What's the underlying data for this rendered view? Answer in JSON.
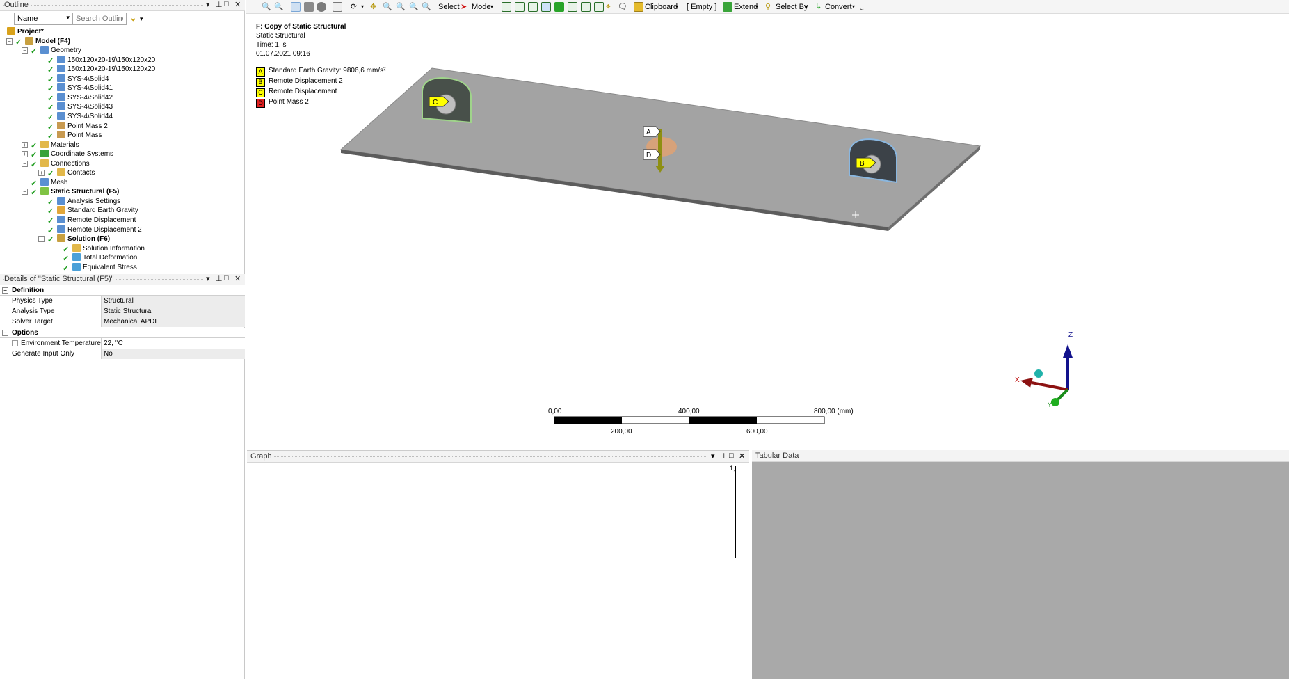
{
  "outline": {
    "title": "Outline",
    "filter_name": "Name",
    "search_placeholder": "Search Outline",
    "tree": [
      {
        "label": "Project*",
        "level": 0,
        "bold": true,
        "icon": "project-icon",
        "icon_color": "#d9a21b"
      },
      {
        "label": "Model (F4)",
        "level": 1,
        "bold": true,
        "icon": "model-icon",
        "icon_color": "#c8a040"
      },
      {
        "label": "Geometry",
        "level": 2,
        "icon": "geometry-icon",
        "icon_color": "#5a8fd1"
      },
      {
        "label": "150x120x20-19\\150x120x20",
        "level": 3,
        "icon": "solid-body-icon",
        "icon_color": "#5a8fd1"
      },
      {
        "label": "150x120x20-19\\150x120x20",
        "level": 3,
        "icon": "solid-body-icon",
        "icon_color": "#5a8fd1"
      },
      {
        "label": "SYS-4\\Solid4",
        "level": 3,
        "icon": "solid-body-icon",
        "icon_color": "#5a8fd1"
      },
      {
        "label": "SYS-4\\Solid41",
        "level": 3,
        "icon": "solid-body-icon",
        "icon_color": "#5a8fd1"
      },
      {
        "label": "SYS-4\\Solid42",
        "level": 3,
        "icon": "solid-body-icon",
        "icon_color": "#5a8fd1"
      },
      {
        "label": "SYS-4\\Solid43",
        "level": 3,
        "icon": "solid-body-icon",
        "icon_color": "#5a8fd1"
      },
      {
        "label": "SYS-4\\Solid44",
        "level": 3,
        "icon": "solid-body-icon",
        "icon_color": "#5a8fd1"
      },
      {
        "label": "Point Mass 2",
        "level": 3,
        "icon": "point-mass-icon",
        "icon_color": "#c89a50"
      },
      {
        "label": "Point Mass",
        "level": 3,
        "icon": "point-mass-icon",
        "icon_color": "#c89a50"
      },
      {
        "label": "Materials",
        "level": 2,
        "icon": "materials-icon",
        "icon_color": "#e2b84a"
      },
      {
        "label": "Coordinate Systems",
        "level": 2,
        "icon": "coordinate-systems-icon",
        "icon_color": "#39a23a"
      },
      {
        "label": "Connections",
        "level": 2,
        "icon": "connections-icon",
        "icon_color": "#e2b84a"
      },
      {
        "label": "Contacts",
        "level": 3,
        "icon": "contacts-icon",
        "icon_color": "#e2b84a"
      },
      {
        "label": "Mesh",
        "level": 2,
        "icon": "mesh-icon",
        "icon_color": "#5a8fd1"
      },
      {
        "label": "Static Structural (F5)",
        "level": 2,
        "bold": true,
        "icon": "static-structural-icon",
        "icon_color": "#7fc343"
      },
      {
        "label": "Analysis Settings",
        "level": 3,
        "icon": "analysis-settings-icon",
        "icon_color": "#5a8fd1"
      },
      {
        "label": "Standard Earth Gravity",
        "level": 3,
        "icon": "gravity-icon",
        "icon_color": "#e2a73a"
      },
      {
        "label": "Remote Displacement",
        "level": 3,
        "icon": "remote-displacement-icon",
        "icon_color": "#5a8fd1"
      },
      {
        "label": "Remote Displacement 2",
        "level": 3,
        "icon": "remote-displacement-icon",
        "icon_color": "#5a8fd1"
      },
      {
        "label": "Solution (F6)",
        "level": 3,
        "bold": true,
        "icon": "solution-icon",
        "icon_color": "#c8a040"
      },
      {
        "label": "Solution Information",
        "level": 4,
        "icon": "solution-information-icon",
        "icon_color": "#e2b84a"
      },
      {
        "label": "Total Deformation",
        "level": 4,
        "icon": "total-deformation-icon",
        "icon_color": "#4aa0d8"
      },
      {
        "label": "Equivalent Stress",
        "level": 4,
        "icon": "equivalent-stress-icon",
        "icon_color": "#4aa0d8"
      }
    ]
  },
  "details": {
    "title": "Details of \"Static Structural (F5)\"",
    "sections": [
      {
        "name": "Definition",
        "rows": [
          {
            "key": "Physics Type",
            "value": "Structural"
          },
          {
            "key": "Analysis Type",
            "value": "Static Structural"
          },
          {
            "key": "Solver Target",
            "value": "Mechanical APDL"
          }
        ]
      },
      {
        "name": "Options",
        "rows": [
          {
            "key": "Environment Temperature",
            "value": "22, °C"
          },
          {
            "key": "Generate Input Only",
            "value": "No"
          }
        ]
      }
    ]
  },
  "toolbar": {
    "select": "Select",
    "mode": "Mode",
    "clipboard": "Clipboard",
    "empty": "[ Empty ]",
    "extend": "Extend",
    "select_by": "Select By",
    "convert": "Convert"
  },
  "viewport": {
    "header": {
      "title": "F: Copy of Static Structural",
      "subtitle": "Static Structural",
      "time": "Time: 1, s",
      "date": "01.07.2021 09:16"
    },
    "legend": [
      {
        "letter": "A",
        "label": "Standard Earth Gravity: 9806,6 mm/s²",
        "color": "#ffff00"
      },
      {
        "letter": "B",
        "label": "Remote Displacement 2",
        "color": "#ffff00"
      },
      {
        "letter": "C",
        "label": "Remote Displacement",
        "color": "#ffff00"
      },
      {
        "letter": "D",
        "label": "Point Mass 2",
        "color": "#e02020"
      }
    ],
    "markers": {
      "a": "A",
      "b": "B",
      "c": "C",
      "d": "D"
    },
    "scale": {
      "top_labels": [
        "0,00",
        "400,00",
        "800,00 (mm)"
      ],
      "bottom_labels": [
        "200,00",
        "600,00"
      ]
    },
    "triad": {
      "x": "X",
      "y": "Y",
      "z": "Z"
    }
  },
  "graph": {
    "title": "Graph",
    "axis_value": "1,"
  },
  "tabular": {
    "title": "Tabular Data"
  }
}
